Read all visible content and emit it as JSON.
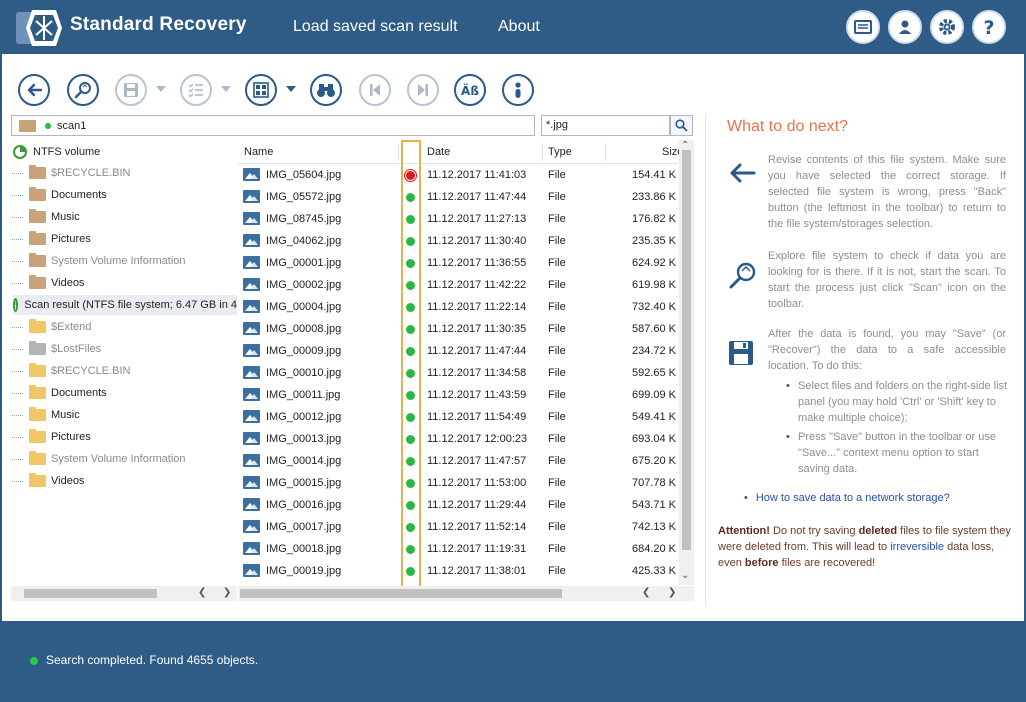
{
  "header": {
    "title": "Standard Recovery",
    "nav": [
      "Load saved scan result",
      "About"
    ],
    "icons": [
      "id-card-icon",
      "user-icon",
      "gear-icon",
      "help-icon"
    ]
  },
  "toolbar": {
    "buttons": [
      "back-icon",
      "scan-icon",
      "save-icon",
      "checklist-icon",
      "view-icon",
      "find-icon",
      "prev-icon",
      "next-icon",
      "case-icon",
      "info-icon"
    ]
  },
  "path": {
    "text": "scan1"
  },
  "search": {
    "value": "*.jpg"
  },
  "tree": {
    "items": [
      {
        "label": "NTFS volume"
      },
      {
        "label": "$RECYCLE.BIN"
      },
      {
        "label": "Documents"
      },
      {
        "label": "Music"
      },
      {
        "label": "Pictures"
      },
      {
        "label": "System Volume Information"
      },
      {
        "label": "Videos"
      },
      {
        "label": "Scan result (NTFS file system; 6.47 GB in 4"
      },
      {
        "label": "$Extend"
      },
      {
        "label": "$LostFiles"
      },
      {
        "label": "$RECYCLE.BIN"
      },
      {
        "label": "Documents"
      },
      {
        "label": "Music"
      },
      {
        "label": "Pictures"
      },
      {
        "label": "System Volume Information"
      },
      {
        "label": "Videos"
      }
    ]
  },
  "files": {
    "columns": [
      "Name",
      "Date",
      "Type",
      "Size"
    ],
    "rows": [
      {
        "name": "IMG_05604.jpg",
        "status": "red",
        "date": "11.12.2017 11:41:03",
        "type": "File",
        "size": "154.41 K"
      },
      {
        "name": "IMG_05572.jpg",
        "status": "green",
        "date": "11.12.2017 11:47:44",
        "type": "File",
        "size": "233.86 K"
      },
      {
        "name": "IMG_08745.jpg",
        "status": "green",
        "date": "11.12.2017 11:27:13",
        "type": "File",
        "size": "176.82 K"
      },
      {
        "name": "IMG_04062.jpg",
        "status": "green",
        "date": "11.12.2017 11:30:40",
        "type": "File",
        "size": "235.35 K"
      },
      {
        "name": "IMG_00001.jpg",
        "status": "green",
        "date": "11.12.2017 11:36:55",
        "type": "File",
        "size": "624.92 K"
      },
      {
        "name": "IMG_00002.jpg",
        "status": "green",
        "date": "11.12.2017 11:42:22",
        "type": "File",
        "size": "619.98 K"
      },
      {
        "name": "IMG_00004.jpg",
        "status": "green",
        "date": "11.12.2017 11:22:14",
        "type": "File",
        "size": "732.40 K"
      },
      {
        "name": "IMG_00008.jpg",
        "status": "green",
        "date": "11.12.2017 11:30:35",
        "type": "File",
        "size": "587.60 K"
      },
      {
        "name": "IMG_00009.jpg",
        "status": "green",
        "date": "11.12.2017 11:47:44",
        "type": "File",
        "size": "234.72 K"
      },
      {
        "name": "IMG_00010.jpg",
        "status": "green",
        "date": "11.12.2017 11:34:58",
        "type": "File",
        "size": "592.65 K"
      },
      {
        "name": "IMG_00011.jpg",
        "status": "green",
        "date": "11.12.2017 11:43:59",
        "type": "File",
        "size": "699.09 K"
      },
      {
        "name": "IMG_00012.jpg",
        "status": "green",
        "date": "11.12.2017 11:54:49",
        "type": "File",
        "size": "549.41 K"
      },
      {
        "name": "IMG_00013.jpg",
        "status": "green",
        "date": "11.12.2017 12:00:23",
        "type": "File",
        "size": "693.04 K"
      },
      {
        "name": "IMG_00014.jpg",
        "status": "green",
        "date": "11.12.2017 11:47:57",
        "type": "File",
        "size": "675.20 K"
      },
      {
        "name": "IMG_00015.jpg",
        "status": "green",
        "date": "11.12.2017 11:53:00",
        "type": "File",
        "size": "707.78 K"
      },
      {
        "name": "IMG_00016.jpg",
        "status": "green",
        "date": "11.12.2017 11:29:44",
        "type": "File",
        "size": "543.71 K"
      },
      {
        "name": "IMG_00017.jpg",
        "status": "green",
        "date": "11.12.2017 11:52:14",
        "type": "File",
        "size": "742.13 K"
      },
      {
        "name": "IMG_00018.jpg",
        "status": "green",
        "date": "11.12.2017 11:19:31",
        "type": "File",
        "size": "684.20 K"
      },
      {
        "name": "IMG_00019.jpg",
        "status": "green",
        "date": "11.12.2017 11:38:01",
        "type": "File",
        "size": "425.33 K"
      }
    ]
  },
  "help": {
    "title": "What to do next?",
    "p1": "Revise contents of this file system. Make sure you have selected the correct storage. If selected file system is wrong, press \"Back\" button (the leftmost in the toolbar) to return to the file system/storages selection.",
    "p2": "Explore file system to check if data you are looking for is there. If it is not, start the scan. To start the process just click \"Scan\" icon on the toolbar.",
    "p3": "After the data is found, you may \"Save\" (or \"Recover\") the data to a safe accessible location. To do this:",
    "bullets": [
      "Select files and folders on the right-side list panel (you may hold 'Ctrl' or 'Shift' key to make multiple choice);",
      "Press \"Save\" button in the toolbar or use \"Save...\" context menu option to start saving data."
    ],
    "link": "How to save data to a network storage?",
    "attention": {
      "label": "Attention!",
      "t1": " Do not try saving ",
      "b1": "deleted",
      "t2": " files to file system they were deleted from. This will lead to ",
      "lnk": "irreversible",
      "t3": " data loss, even ",
      "b2": "before",
      "t4": " files are recovered!"
    }
  },
  "status": {
    "text": "Search completed. Found 4655 objects."
  },
  "colors": {
    "header_bg": "#2f5c86",
    "accent": "#2a5a8a",
    "ok": "#27b845",
    "error": "#e01818",
    "highlight": "#e8b24a",
    "help_title": "#e8724a"
  }
}
